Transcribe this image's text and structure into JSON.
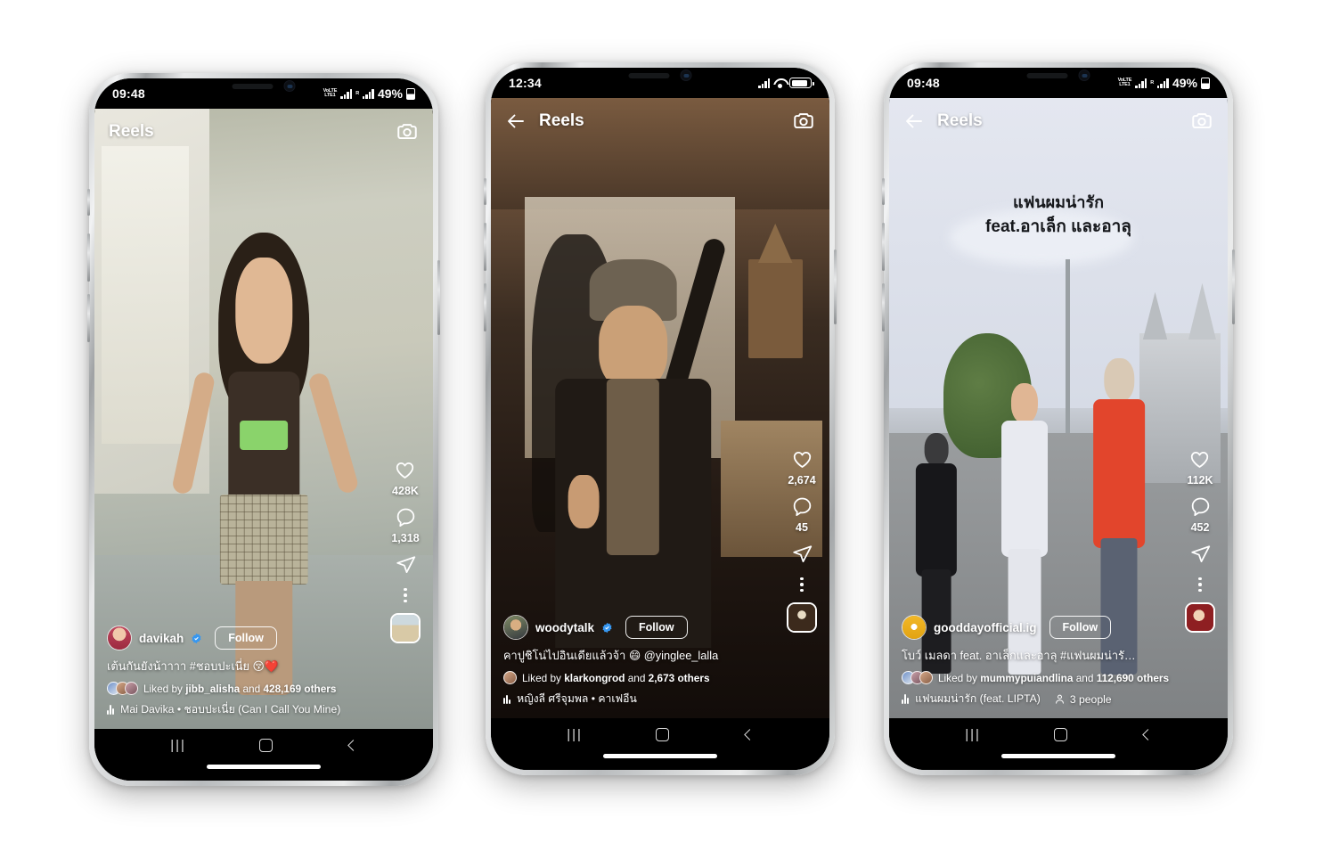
{
  "page": {
    "background_color": "#ffffff",
    "description": "Three smartphone mockups showing Instagram Reels screens"
  },
  "phones": [
    {
      "id": "phone-1",
      "status_bar": {
        "time": "09:48",
        "style": "android",
        "volte_label_top": "VoLTE",
        "volte_label_bottom": "LTE1",
        "roaming_label": "R",
        "battery_percent": "49%"
      },
      "app_bar": {
        "title": "Reels",
        "has_back": false,
        "camera_icon": "camera-icon"
      },
      "actions": {
        "like": {
          "icon": "heart-icon",
          "count": "428K"
        },
        "comment": {
          "icon": "comment-icon",
          "count": "1,318"
        },
        "share": {
          "icon": "share-icon",
          "count": ""
        },
        "more": {
          "icon": "more-options-icon"
        },
        "audio_thumbnail": "audio-cover-thumbnail"
      },
      "post": {
        "username": "davikah",
        "verified": true,
        "follow_label": "Follow",
        "caption": "เต้นกันยังน้าาาา #ชอบปะเนี่ย 😚❤️",
        "likes_prefix": "Liked by",
        "likes_user": "jibb_alisha",
        "likes_middle": "and",
        "likes_count": "428,169 others",
        "audio": "Mai Davika • ชอบปะเนี่ย (Can I Call You Mine)",
        "people_label": ""
      },
      "nav_bar": {
        "recents_icon": "recents-icon",
        "home_icon": "home-icon",
        "back_icon": "back-icon",
        "home_indicator": true
      }
    },
    {
      "id": "phone-2",
      "status_bar": {
        "time": "12:34",
        "style": "ios",
        "volte_label_top": "",
        "volte_label_bottom": "",
        "roaming_label": "",
        "battery_percent": ""
      },
      "app_bar": {
        "title": "Reels",
        "has_back": true,
        "camera_icon": "camera-icon"
      },
      "actions": {
        "like": {
          "icon": "heart-icon",
          "count": "2,674"
        },
        "comment": {
          "icon": "comment-icon",
          "count": "45"
        },
        "share": {
          "icon": "share-icon",
          "count": ""
        },
        "more": {
          "icon": "more-options-icon"
        },
        "audio_thumbnail": "audio-cover-thumbnail"
      },
      "post": {
        "username": "woodytalk",
        "verified": true,
        "follow_label": "Follow",
        "caption": "คาปูชิโน่ไปอินเดียแล้วจ้า 😄 @yinglee_lalla",
        "likes_prefix": "Liked by",
        "likes_user": "klarkongrod",
        "likes_middle": "and",
        "likes_count": "2,673 others",
        "audio": "หญิงลี ศรีจุมพล • คาเฟอีน",
        "people_label": ""
      },
      "nav_bar": {
        "recents_icon": "recents-icon",
        "home_icon": "home-icon",
        "back_icon": "back-icon",
        "home_indicator": true
      }
    },
    {
      "id": "phone-3",
      "status_bar": {
        "time": "09:48",
        "style": "android",
        "volte_label_top": "VoLTE",
        "volte_label_bottom": "LTE1",
        "roaming_label": "R",
        "battery_percent": "49%"
      },
      "app_bar": {
        "title": "Reels",
        "has_back": true,
        "camera_icon": "camera-icon"
      },
      "actions": {
        "like": {
          "icon": "heart-icon",
          "count": "112K"
        },
        "comment": {
          "icon": "comment-icon",
          "count": "452"
        },
        "share": {
          "icon": "share-icon",
          "count": ""
        },
        "more": {
          "icon": "more-options-icon"
        },
        "audio_thumbnail": "audio-cover-thumbnail"
      },
      "post": {
        "username": "gooddayofficial.ig",
        "verified": false,
        "follow_label": "Follow",
        "caption": "โบว์ เมลดา feat. อาเล็กและอาลุ #แฟนผมน่ารัก ...",
        "likes_prefix": "Liked by",
        "likes_user": "mummypuiandlina",
        "likes_middle": "and",
        "likes_count": "112,690 others",
        "audio": "แฟนผมน่ารัก (feat. LIPTA)",
        "people_label": "3 people"
      },
      "video_overlay": {
        "line1": "แฟนผมน่ารัก",
        "line2_bold": "feat.",
        "line2_rest": "อาเล็ก และอาลุ"
      },
      "nav_bar": {
        "recents_icon": "recents-icon",
        "home_icon": "home-icon",
        "back_icon": "back-icon",
        "home_indicator": true
      }
    }
  ]
}
